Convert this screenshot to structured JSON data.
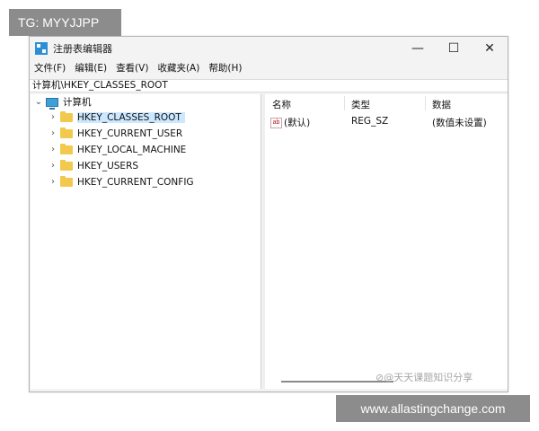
{
  "watermark_top": "TG: MYYJJPP",
  "watermark_bottom": "www.allastingchange.com",
  "watermark_right": "⊘@天天课题知识分享",
  "window": {
    "title": "注册表编辑器",
    "controls": {
      "minimize": "—",
      "maximize": "☐",
      "close": "✕"
    }
  },
  "menu": [
    {
      "label": "文件(F)"
    },
    {
      "label": "编辑(E)"
    },
    {
      "label": "查看(V)"
    },
    {
      "label": "收藏夹(A)"
    },
    {
      "label": "帮助(H)"
    }
  ],
  "address": "计算机\\HKEY_CLASSES_ROOT",
  "tree": {
    "root": {
      "chevron": "⌄",
      "label": "计算机"
    },
    "children": [
      {
        "chevron": "›",
        "label": "HKEY_CLASSES_ROOT",
        "selected": true
      },
      {
        "chevron": "›",
        "label": "HKEY_CURRENT_USER"
      },
      {
        "chevron": "›",
        "label": "HKEY_LOCAL_MACHINE"
      },
      {
        "chevron": "›",
        "label": "HKEY_USERS"
      },
      {
        "chevron": "›",
        "label": "HKEY_CURRENT_CONFIG"
      }
    ]
  },
  "columns": {
    "name": "名称",
    "type": "类型",
    "data": "数据"
  },
  "values": [
    {
      "icon_text": "ab",
      "name": "(默认)",
      "type": "REG_SZ",
      "data": "(数值未设置)"
    }
  ],
  "colors": {
    "selection": "#cce8ff",
    "folder": "#f2c94c",
    "accent": "#2b8fd6"
  }
}
